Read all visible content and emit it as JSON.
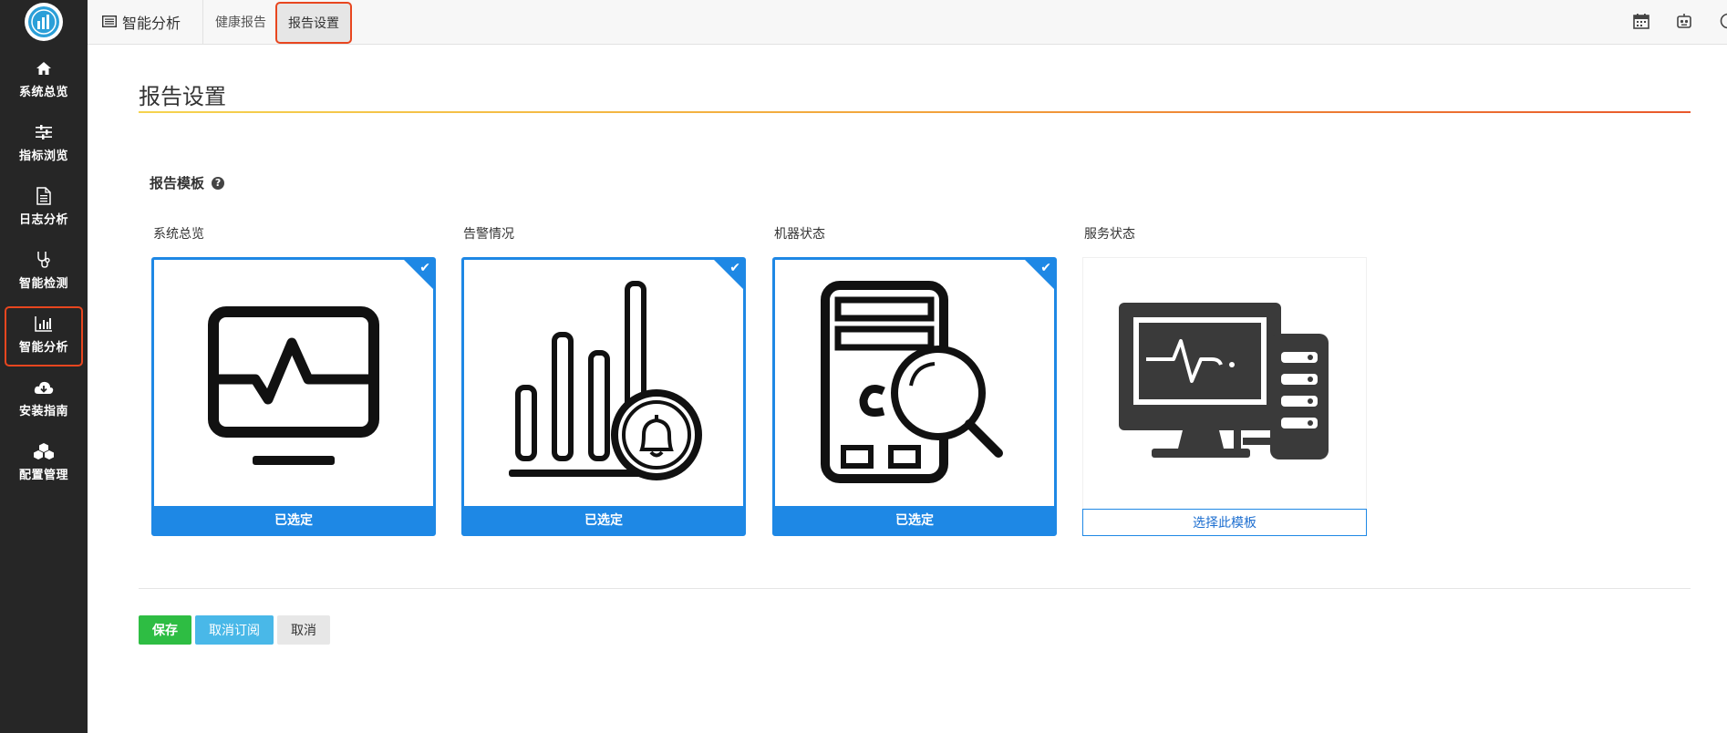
{
  "sidebar": {
    "logo_icon": "analytics-logo-icon",
    "items": [
      {
        "label": "系统总览",
        "icon": "home-icon"
      },
      {
        "label": "指标浏览",
        "icon": "sliders-icon"
      },
      {
        "label": "日志分析",
        "icon": "document-icon"
      },
      {
        "label": "智能检测",
        "icon": "stethoscope-icon"
      },
      {
        "label": "智能分析",
        "icon": "bar-chart-icon",
        "active": true
      },
      {
        "label": "安装指南",
        "icon": "cloud-download-icon"
      },
      {
        "label": "配置管理",
        "icon": "cubes-icon"
      }
    ]
  },
  "topbar": {
    "app_title": "智能分析",
    "tabs": [
      {
        "label": "健康报告"
      },
      {
        "label": "报告设置",
        "active": true
      }
    ],
    "right_icons": [
      "calendar-icon",
      "robot-icon",
      "clock-icon"
    ]
  },
  "page": {
    "title": "报告设置",
    "section_label": "报告模板",
    "help_icon": "question-circle-icon"
  },
  "templates": [
    {
      "name": "系统总览",
      "selected": true,
      "button_label": "已选定",
      "icon": "monitor-pulse-icon"
    },
    {
      "name": "告警情况",
      "selected": true,
      "button_label": "已选定",
      "icon": "bar-chart-bell-icon"
    },
    {
      "name": "机器状态",
      "selected": true,
      "button_label": "已选定",
      "icon": "machine-search-icon"
    },
    {
      "name": "服务状态",
      "selected": false,
      "button_label": "选择此模板",
      "icon": "computer-server-icon"
    }
  ],
  "actions": {
    "save_label": "保存",
    "unsubscribe_label": "取消订阅",
    "cancel_label": "取消"
  },
  "colors": {
    "accent_blue": "#1e88e5",
    "save_green": "#2ebd43",
    "unsubscribe_blue": "#49b8e8",
    "active_outline": "#e8461f",
    "sidebar_bg": "#262626"
  }
}
